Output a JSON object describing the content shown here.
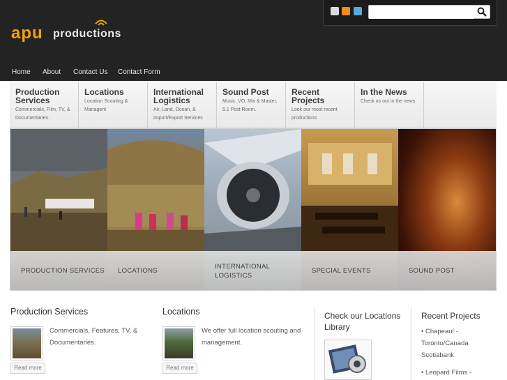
{
  "header": {
    "logo_apu": "apu",
    "logo_productions": "productions",
    "search_placeholder": ""
  },
  "nav": [
    {
      "label": "Home"
    },
    {
      "label": "About"
    },
    {
      "label": "Contact Us"
    },
    {
      "label": "Contact Form"
    }
  ],
  "menu": [
    {
      "title": "Production Services",
      "desc": "Commercials, Film, TV, & Documentaries."
    },
    {
      "title": "Locations",
      "desc": "Location Scouting & Managent"
    },
    {
      "title": "International Logistics",
      "desc": "Air, Land, Ocean, & Import/Export Services"
    },
    {
      "title": "Sound Post",
      "desc": "Music, VO, Mix & Master, 5.1 Post Room."
    },
    {
      "title": "Recent Projects",
      "desc": "Look our most recent productions"
    },
    {
      "title": "In the News",
      "desc": "Check us out in the news"
    }
  ],
  "slider": [
    {
      "caption": "PRODUCTION SERVICES"
    },
    {
      "caption": "LOCATIONS"
    },
    {
      "caption_line1": "INTERNATIONAL",
      "caption_line2": "LOGISTICS"
    },
    {
      "caption": "SPECIAL EVENTS"
    },
    {
      "caption": "SOUND POST"
    }
  ],
  "sections": {
    "production": {
      "title": "Production Services",
      "text_line1": "Commercials, Features, TV, &",
      "text_line2": "Documentaries.",
      "readmore": "Read more"
    },
    "locations": {
      "title": "Locations",
      "text_line1": "We offer full location scouting and",
      "text_line2": "management.",
      "readmore": "Read more"
    },
    "library": {
      "title_line1": "Check our Locations",
      "title_line2": "Library"
    },
    "recent": {
      "title": "Recent Projects",
      "items": [
        {
          "line1": "• Chapeau! -",
          "line2": "Toronto/Canada",
          "line3": "Scotiabank"
        },
        {
          "line1": "• Leopard Films -"
        }
      ]
    }
  },
  "colors": {
    "header_bg": "#232323",
    "logo_accent": "#f5a300"
  }
}
